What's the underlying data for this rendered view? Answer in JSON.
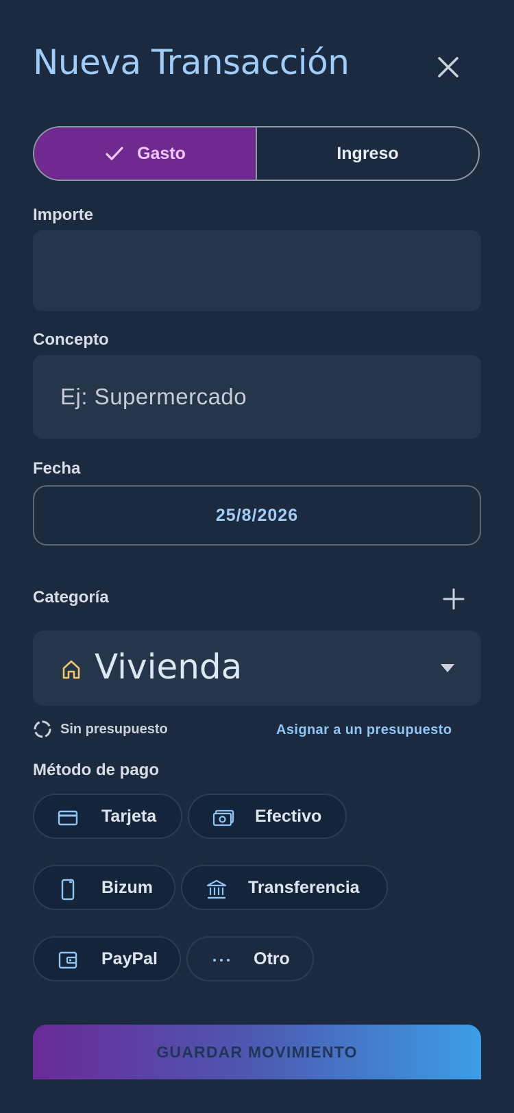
{
  "header": {
    "title": "Nueva Transacción"
  },
  "type_toggle": {
    "options": [
      {
        "label": "Gasto",
        "selected": true
      },
      {
        "label": "Ingreso",
        "selected": false
      }
    ]
  },
  "amount": {
    "label": "Importe",
    "value": "",
    "placeholder": ""
  },
  "concept": {
    "label": "Concepto",
    "value": "",
    "placeholder": "Ej: Supermercado"
  },
  "date": {
    "label": "Fecha",
    "value": "25/8/2026"
  },
  "category": {
    "label": "Categoría",
    "selected": "Vivienda",
    "icon": "house-icon"
  },
  "budget": {
    "status": "Sin presupuesto",
    "assign_link": "Asignar a un presupuesto"
  },
  "payment": {
    "label": "Método de pago",
    "methods": [
      {
        "label": "Tarjeta",
        "icon": "credit-card-icon"
      },
      {
        "label": "Efectivo",
        "icon": "cash-icon"
      },
      {
        "label": "Bizum",
        "icon": "phone-icon"
      },
      {
        "label": "Transferencia",
        "icon": "bank-icon"
      },
      {
        "label": "PayPal",
        "icon": "wallet-icon"
      },
      {
        "label": "Otro",
        "icon": "more-icon"
      }
    ]
  },
  "actions": {
    "save_label": "GUARDAR MOVIMIENTO"
  },
  "colors": {
    "background": "#1b2a3f",
    "accent": "#9fcdf8",
    "expense_active": "#702a8f",
    "field": "#26364a"
  }
}
